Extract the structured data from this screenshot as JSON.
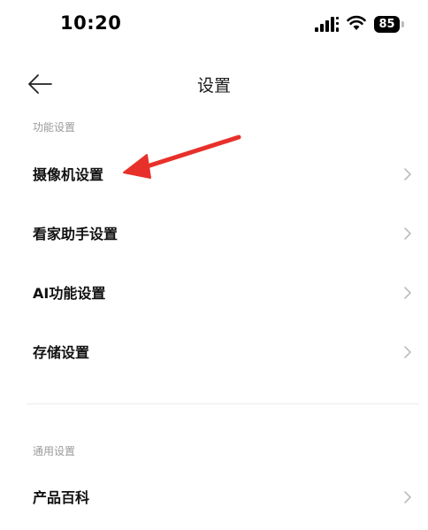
{
  "status_bar": {
    "time": "10:20",
    "battery": "85",
    "icons": [
      "signal-icon",
      "wifi-icon",
      "battery-icon"
    ]
  },
  "header": {
    "title": "设置",
    "back_icon": "back-arrow-icon"
  },
  "sections": [
    {
      "label": "功能设置",
      "items": [
        {
          "label": "摄像机设置"
        },
        {
          "label": "看家助手设置"
        },
        {
          "label": "AI功能设置"
        },
        {
          "label": "存储设置"
        }
      ]
    },
    {
      "label": "通用设置",
      "items": [
        {
          "label": "产品百科"
        }
      ]
    }
  ],
  "annotation": {
    "arrow_color": "#e8302a",
    "points_to": "摄像机设置"
  }
}
